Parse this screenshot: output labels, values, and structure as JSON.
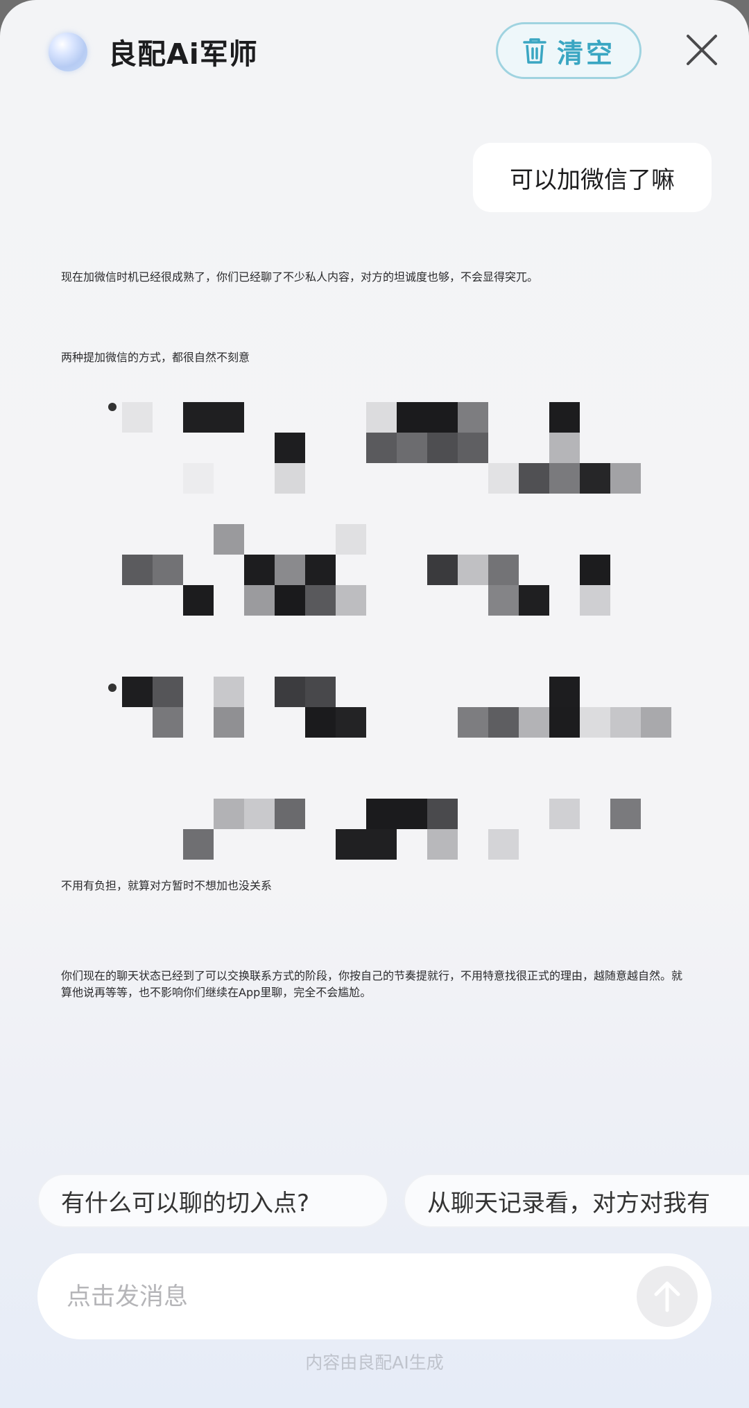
{
  "header": {
    "title": "良配Ai军师",
    "clear_label": "清空",
    "icons": {
      "avatar": "ai-orb-icon",
      "clear": "trash-icon",
      "close": "close-icon"
    }
  },
  "conversation": {
    "user_message": "可以加微信了嘛",
    "assistant_reply": {
      "intro": "现在加微信时机已经很成熟了，你们已经聊了不少私人内容，对方的坦诚度也够，不会显得突兀。",
      "heading1": "两种提加微信的方式，都很自然不刻意",
      "bullets_note": "bullet content pixelated / obscured",
      "heading2": "不用有负担，就算对方暂时不想加也没关系",
      "closing": "你们现在的聊天状态已经到了可以交换联系方式的阶段，你按自己的节奏提就行，不用特意找很正式的理由，越随意越自然。就算他说再等等，也不影响你们继续在App里聊，完全不会尴尬。"
    }
  },
  "suggestions": [
    "有什么可以聊的切入点?",
    "从聊天记录看，对方对我有"
  ],
  "composer": {
    "placeholder": "点击发消息",
    "send_icon": "arrow-up-icon"
  },
  "footer": {
    "note": "内容由良配AI生成"
  },
  "colors": {
    "accent": "#3aa6c2",
    "accent_border": "#9fd3e0",
    "text": "#1c1c1e",
    "background": "#f4f4f6"
  }
}
